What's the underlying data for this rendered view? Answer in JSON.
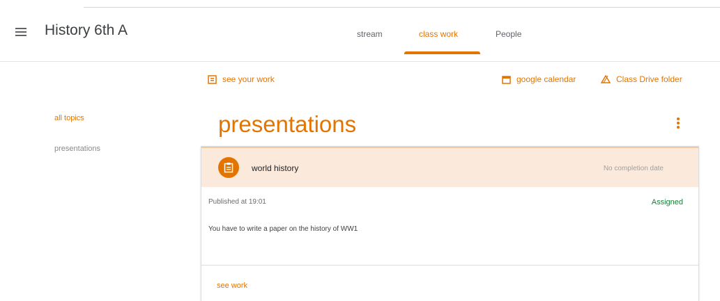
{
  "header": {
    "class_title": "History 6th A",
    "tabs": [
      {
        "label": "stream"
      },
      {
        "label": "class work"
      },
      {
        "label": "People"
      }
    ],
    "active_tab": "class work"
  },
  "actions": {
    "see_your_work": "see your work",
    "google_calendar": "google calendar",
    "class_drive_folder": "Class Drive folder"
  },
  "sidebar": {
    "items": [
      {
        "label": "all topics"
      },
      {
        "label": "presentations"
      }
    ]
  },
  "topic": {
    "title": "presentations"
  },
  "assignment": {
    "title": "world history",
    "due": "No completion date",
    "published": "Published at 19:01",
    "status": "Assigned",
    "description": "You have to write a paper on the history of WW1",
    "see_work_label": "see work"
  },
  "colors": {
    "accent": "#e37400",
    "card_header_bg": "#fbeadb",
    "status_green": "#188038"
  },
  "icons": [
    "menu-icon",
    "assignment-icon",
    "calendar-icon",
    "drive-folder-icon",
    "more-vert-icon",
    "clipboard-icon"
  ]
}
